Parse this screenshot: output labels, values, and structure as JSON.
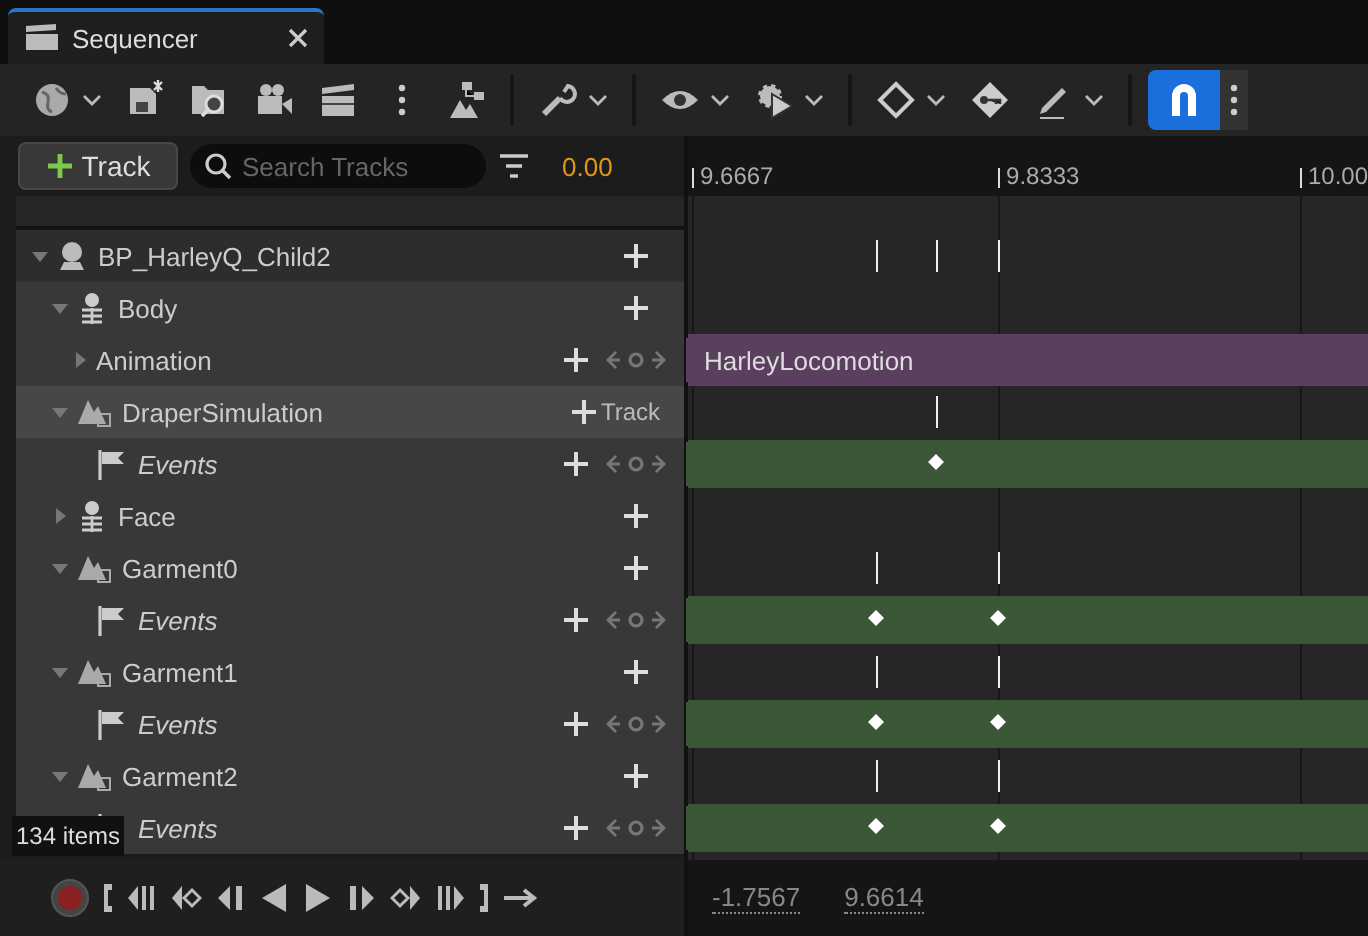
{
  "tab": {
    "title": "Sequencer",
    "selected": true
  },
  "toolbar": {
    "snapping": {
      "selected": true
    }
  },
  "track_bar": {
    "add_button": "Track",
    "search": {
      "placeholder": "Search Tracks"
    },
    "current_time": "0.00"
  },
  "ruler": {
    "labels": [
      "9.6667",
      "9.8333",
      "10.00"
    ]
  },
  "tracks": [
    {
      "label": "BP_HarleyQ_Child2",
      "kind": "actor",
      "expanded": true,
      "highlighted": false,
      "action": {
        "kind": "add"
      },
      "lane": {
        "kind": "empty"
      },
      "children": [
        {
          "label": "Body",
          "kind": "skeleton",
          "expanded": true,
          "highlighted": false,
          "action": {
            "kind": "add"
          },
          "lane": {
            "kind": "empty"
          },
          "children": [
            {
              "label": "Animation",
              "kind": "plain",
              "expanded": false,
              "highlighted": false,
              "action": {
                "kind": "add-nav"
              },
              "lane": {
                "kind": "section",
                "label": "HarleyLocomotion",
                "color": "#5b3f5e"
              }
            }
          ]
        },
        {
          "label": "DraperSimulation",
          "kind": "cloth",
          "expanded": true,
          "highlighted": true,
          "action": {
            "kind": "add-track",
            "label": "Track"
          },
          "lane": {
            "kind": "empty"
          },
          "children": [
            {
              "label": "Events",
              "kind": "event",
              "highlighted": false,
              "action": {
                "kind": "add-nav"
              },
              "lane": {
                "kind": "event",
                "color": "#3b5737"
              }
            }
          ]
        },
        {
          "label": "Face",
          "kind": "skeleton",
          "expanded": false,
          "highlighted": false,
          "action": {
            "kind": "add"
          },
          "lane": {
            "kind": "empty"
          }
        },
        {
          "label": "Garment0",
          "kind": "cloth",
          "expanded": true,
          "highlighted": false,
          "action": {
            "kind": "add"
          },
          "lane": {
            "kind": "empty"
          },
          "children": [
            {
              "label": "Events",
              "kind": "event",
              "highlighted": false,
              "action": {
                "kind": "add-nav"
              },
              "lane": {
                "kind": "event",
                "color": "#3b5737"
              }
            }
          ]
        },
        {
          "label": "Garment1",
          "kind": "cloth",
          "expanded": true,
          "highlighted": false,
          "action": {
            "kind": "add"
          },
          "lane": {
            "kind": "empty"
          },
          "children": [
            {
              "label": "Events",
              "kind": "event",
              "highlighted": false,
              "action": {
                "kind": "add-nav"
              },
              "lane": {
                "kind": "event",
                "color": "#3b5737"
              }
            }
          ]
        },
        {
          "label": "Garment2",
          "kind": "cloth",
          "expanded": true,
          "highlighted": false,
          "action": {
            "kind": "add"
          },
          "lane": {
            "kind": "empty"
          },
          "children": [
            {
              "label": "Events",
              "kind": "event",
              "highlighted": false,
              "action": {
                "kind": "add-nav"
              },
              "lane": {
                "kind": "event",
                "color": "#3b5737"
              }
            }
          ]
        }
      ]
    }
  ],
  "item_count": "134 items",
  "transport": {
    "readouts": [
      "-1.7567",
      "9.6614"
    ]
  }
}
